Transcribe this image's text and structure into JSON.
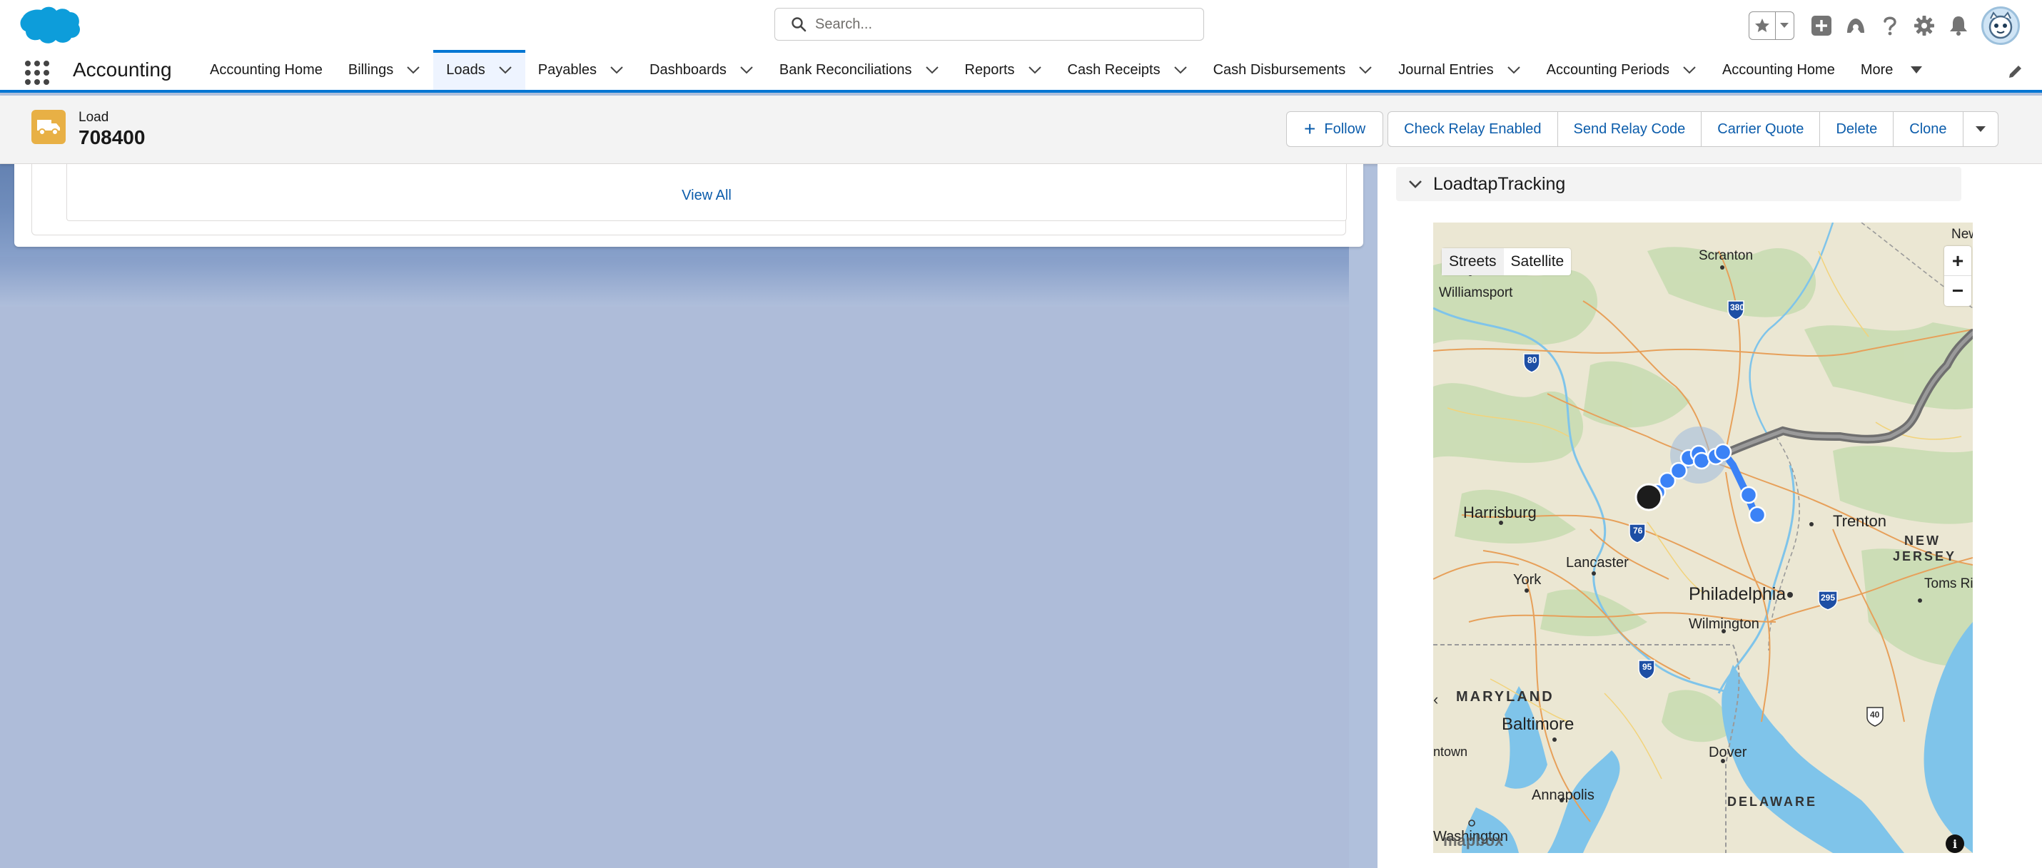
{
  "header": {
    "search_placeholder": "Search..."
  },
  "nav": {
    "app_name": "Accounting",
    "items": [
      {
        "label": "Accounting Home",
        "chevron": false
      },
      {
        "label": "Billings",
        "chevron": true
      },
      {
        "label": "Loads",
        "chevron": true,
        "active": true
      },
      {
        "label": "Payables",
        "chevron": true
      },
      {
        "label": "Dashboards",
        "chevron": true
      },
      {
        "label": "Bank Reconciliations",
        "chevron": true
      },
      {
        "label": "Reports",
        "chevron": true
      },
      {
        "label": "Cash Receipts",
        "chevron": true
      },
      {
        "label": "Cash Disbursements",
        "chevron": true
      },
      {
        "label": "Journal Entries",
        "chevron": true
      },
      {
        "label": "Accounting Periods",
        "chevron": true
      },
      {
        "label": "Accounting Home",
        "chevron": false
      },
      {
        "label": "More",
        "chevron": false,
        "caret": true
      }
    ]
  },
  "record": {
    "type_label": "Load",
    "title": "708400",
    "follow_label": "Follow",
    "actions": [
      "Check Relay Enabled",
      "Send Relay Code",
      "Carrier Quote",
      "Delete",
      "Clone"
    ]
  },
  "related": {
    "view_all_label": "View All"
  },
  "tracking": {
    "section_title": "LoadtapTracking",
    "map": {
      "streets_label": "Streets",
      "satellite_label": "Satellite",
      "zoom_in": "+",
      "zoom_out": "−",
      "info": "i",
      "attribution": "mapbox",
      "labels": {
        "scranton": "Scranton",
        "williamsport": "Williamsport",
        "harrisburg": "Harrisburg",
        "lancaster": "Lancaster",
        "york": "York",
        "trenton": "Trenton",
        "new_jersey_1": "NEW",
        "new_jersey_2": "JERSEY",
        "toms_river": "Toms Riv",
        "philadelphia": "Philadelphia",
        "wilmington": "Wilmington",
        "maryland": "MARYLAND",
        "baltimore": "Baltimore",
        "dover": "Dover",
        "annapolis": "Annapolis",
        "delaware": "DELAWARE",
        "washington": "Washington",
        "allentown": "ntown",
        "new_york": "New",
        "i380": "380",
        "i80": "80",
        "i76": "76",
        "i295": "295",
        "i95": "95",
        "us40": "40"
      }
    }
  },
  "colors": {
    "brand_blue": "#0176d3",
    "link_blue": "#0b5cab",
    "record_icon": "#e8b045",
    "route_blue": "#3b82f6"
  }
}
